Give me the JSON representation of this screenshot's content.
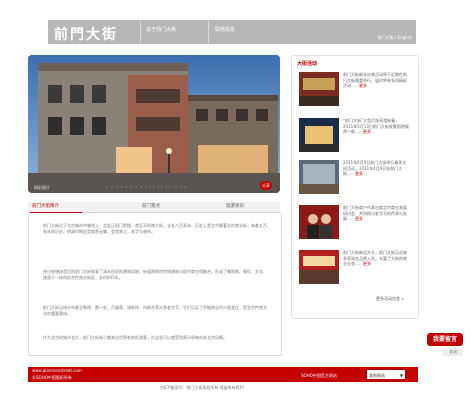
{
  "header": {
    "logo": "前門大街",
    "nav": [
      "关于前门大街",
      "联络信息"
    ],
    "right_text": "前门大街 | English"
  },
  "hero": {
    "caption": "精彩图片",
    "pager": "1 2 3 4 5 6 7 8 9 10 11 12 13 14",
    "close": "分享"
  },
  "tabs": [
    "前门大街简介",
    "前门景点",
    "旅游资讯"
  ],
  "article": {
    "paragraphs": [
      "前门大街位于北京城市中轴线上，北起正阳门箭楼，南至天桥南大街，全长八百多米，历史上是北京最著名的商业街，有着五百多年的历史。明清时期这里商贾云集，会馆林立，老字号遍布。",
      "经过修缮改造后的前门大街恢复了清末民初的建筑风貌，街道两侧的传统建筑与现代商业相融合，形成了集购物、餐饮、文化、旅游于一体的综合性商业街区，长约845米。",
      "前门大街沿线分布着全聚德、都一处、月盛斋、瑞蚨祥、内联升等众多老字号，它们见证了京城商业的兴衰变迁，是北京传统文化的重要载体。",
      "作为北京的城市名片，前门大街吸引着来自世界各地的游客，在这里可以感受到原汁原味的老北京风情。"
    ]
  },
  "news": {
    "title": "大街活动",
    "items": [
      {
        "text": "前门大街新年庆典活动将于近期在前门大街隆重举行，届时将有多项精彩活动……",
        "more": "更多"
      },
      {
        "text": "“前门大街”大型灯饰亮相新春，2011年5月13日前门大街夜景照明焕然一新……",
        "more": "更多"
      },
      {
        "text": "2011年4月9日前门大街举行春季文化活动，2011年4月9日在前门大街……",
        "more": "更多"
      },
      {
        "text": "前门大街商户代表出席北京商业发展研讨会，共同探讨老字号的传承与发展……",
        "more": "更多"
      },
      {
        "text": "前门大街新店开业，前门大街又迎来多家知名品牌入驻，丰富了大街的商业业态……",
        "more": "更多"
      }
    ],
    "more_link": "更多活动信息 »"
  },
  "sticky": {
    "label": "我要留言",
    "close": "关闭"
  },
  "footer": {
    "url": "www.qianmenstreet.com",
    "corp": "©SOHO中国版权所有",
    "right": "SOHO中国官方网站",
    "select": "其他网站",
    "copyright": "京ICP备案号：前门大街版权所有 保留所有权利"
  }
}
